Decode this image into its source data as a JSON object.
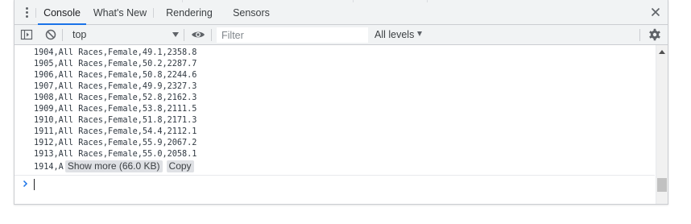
{
  "tabs": [
    {
      "label": "Console",
      "active": true
    },
    {
      "label": "What's New",
      "active": false
    },
    {
      "label": "Rendering",
      "active": false
    },
    {
      "label": "Sensors",
      "active": false
    }
  ],
  "toolbar": {
    "context": "top",
    "filter_placeholder": "Filter",
    "log_levels": "All levels"
  },
  "console": {
    "lines": [
      "1904,All Races,Female,49.1,2358.8",
      "1905,All Races,Female,50.2,2287.7",
      "1906,All Races,Female,50.8,2244.6",
      "1907,All Races,Female,49.9,2327.3",
      "1908,All Races,Female,52.8,2162.3",
      "1909,All Races,Female,53.8,2111.5",
      "1910,All Races,Female,51.8,2171.3",
      "1911,All Races,Female,54.4,2112.1",
      "1912,All Races,Female,55.9,2067.2",
      "1913,All Races,Female,55.0,2058.1"
    ],
    "truncated_line": "1914,A",
    "show_more_label": "Show more (66.0 KB)",
    "copy_label": "Copy",
    "prompt_value": ""
  },
  "colors": {
    "accent": "#1a73e8",
    "toolbar_bg": "#f1f3f4",
    "text": "#303942"
  },
  "icons": {
    "menu": "kebab-menu-icon",
    "close": "close-icon",
    "sidebar": "toggle-sidebar-icon",
    "clear": "clear-console-icon",
    "eye": "live-expression-eye-icon",
    "settings": "gear-icon",
    "prompt": "chevron-right-icon"
  }
}
